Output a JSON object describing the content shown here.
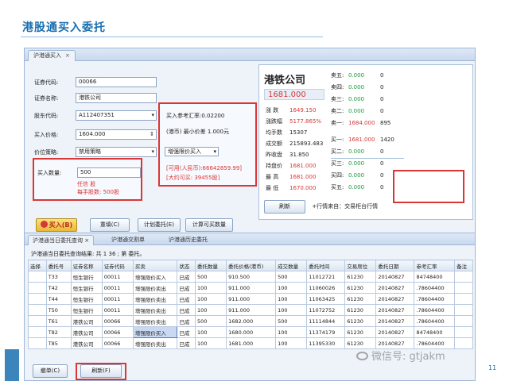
{
  "slide": {
    "title": "港股通买入委托",
    "page_number": "11",
    "watermark": "微信号: gtjakm"
  },
  "top_tabs": [
    {
      "label": "沪港通买入",
      "close": "×"
    }
  ],
  "order_form": {
    "security_code_label": "证券代码:",
    "security_code": "00066",
    "security_name_label": "证券名称:",
    "security_name": "港铁公司",
    "account_label": "股东代码:",
    "account": "A112407351",
    "price_label": "买入价格:",
    "price": "1604.000",
    "strategy_label": "价位策略:",
    "strategy": "禁用策略",
    "qty_label": "买入数量:",
    "qty": "500",
    "qty_unit_caption": "任信 股",
    "lot_caption": "每手股数: 500股"
  },
  "reference_box": {
    "fx_rate": "买入参考汇率:0.02200",
    "currency_label": "(港币) 最小价差 1.000元",
    "order_type": "增强限价买入",
    "available_cny": "[可用(人民币):66642859.99]",
    "max_buy": "[大约可买: 39455股]"
  },
  "buttons": {
    "buy": "买入(B)",
    "reset": "重填(C)",
    "calc": "计划委托(E)",
    "calc_qty": "计算可买数量",
    "refresh": "刷新",
    "refresh_check": "+行情来自：交易柜台行情"
  },
  "quote": {
    "name": "港铁公司",
    "price": "1681.000",
    "stats": [
      {
        "k": "涨 跌",
        "v": "1649.150",
        "blk": false
      },
      {
        "k": "涨跌幅",
        "v": "5177.865%",
        "blk": false
      },
      {
        "k": "均手数",
        "v": "15307",
        "blk": true
      },
      {
        "k": "成交额",
        "v": "215893.483",
        "blk": true
      },
      {
        "k": "昨收盘",
        "v": "31.850",
        "blk": true
      },
      {
        "k": "持盘价",
        "v": "1681.000",
        "blk": false
      },
      {
        "k": "最 高",
        "v": "1681.000",
        "blk": false
      },
      {
        "k": "最 低",
        "v": "1670.000",
        "blk": false
      }
    ],
    "asks": [
      {
        "k": "卖五:",
        "p": "0.000",
        "s": "0"
      },
      {
        "k": "卖四:",
        "p": "0.000",
        "s": "0"
      },
      {
        "k": "卖三:",
        "p": "0.000",
        "s": "0"
      },
      {
        "k": "卖二:",
        "p": "0.000",
        "s": "0"
      },
      {
        "k": "卖一:",
        "p": "1684.000",
        "s": "895"
      }
    ],
    "bids": [
      {
        "k": "买一:",
        "p": "1681.000",
        "s": "1420"
      },
      {
        "k": "买二:",
        "p": "0.000",
        "s": "0"
      },
      {
        "k": "买三:",
        "p": "0.000",
        "s": "0"
      },
      {
        "k": "买四:",
        "p": "0.000",
        "s": "0"
      },
      {
        "k": "买五:",
        "p": "0.000",
        "s": "0"
      }
    ]
  },
  "bottom_tabs": [
    "沪港通当日委托查询 ×",
    "沪港通交割单",
    "沪港通历史委托"
  ],
  "query_result": "沪港通当日委托查询结果: 共 1 36 ; 第 委托。",
  "table": {
    "headers": [
      "选择",
      "委托号",
      "证券名称",
      "证券代码",
      "买卖",
      "状态",
      "委托数量",
      "委托价格(港币)",
      "成交数量",
      "委托时间",
      "交易席位",
      "委托日期",
      "参考汇率",
      "备注"
    ],
    "rows": [
      [
        "",
        "T33",
        "恒生银行",
        "00011",
        "增强限价买入",
        "已成",
        "500",
        "910.500",
        "500",
        "11012721",
        "61230",
        "20140827",
        "84748400",
        ""
      ],
      [
        "",
        "T42",
        "恒生银行",
        "00011",
        "增强限价卖出",
        "已成",
        "100",
        "911.000",
        "100",
        "11060026",
        "61230",
        "20140827",
        ".78604400",
        ""
      ],
      [
        "",
        "T44",
        "恒生银行",
        "00011",
        "增强限价卖出",
        "已成",
        "100",
        "911.000",
        "100",
        "11063425",
        "61230",
        "20140827",
        ".78604400",
        ""
      ],
      [
        "",
        "T50",
        "恒生银行",
        "00011",
        "增强限价卖出",
        "已成",
        "100",
        "911.000",
        "100",
        "11072752",
        "61230",
        "20140827",
        ".78604400",
        ""
      ],
      [
        "",
        "T61",
        "港铁公司",
        "00066",
        "增强限价卖出",
        "已成",
        "500",
        "1682.000",
        "500",
        "11114844",
        "61230",
        "20140827",
        ".78604400",
        ""
      ],
      [
        "",
        "T82",
        "港铁公司",
        "00066",
        "增强限价买入",
        "已成",
        "100",
        "1680.000",
        "100",
        "11374179",
        "61230",
        "20140827",
        "84748400",
        ""
      ],
      [
        "",
        "T85",
        "港铁公司",
        "00066",
        "增强限价卖出",
        "已成",
        "100",
        "1681.000",
        "100",
        "11395330",
        "61230",
        "20140827",
        ".78604400",
        ""
      ]
    ],
    "highlight_row": 5,
    "highlight_col": 4
  },
  "bottom_buttons": {
    "cancel": "撤单(C)",
    "refresh": "刷新(F)"
  }
}
